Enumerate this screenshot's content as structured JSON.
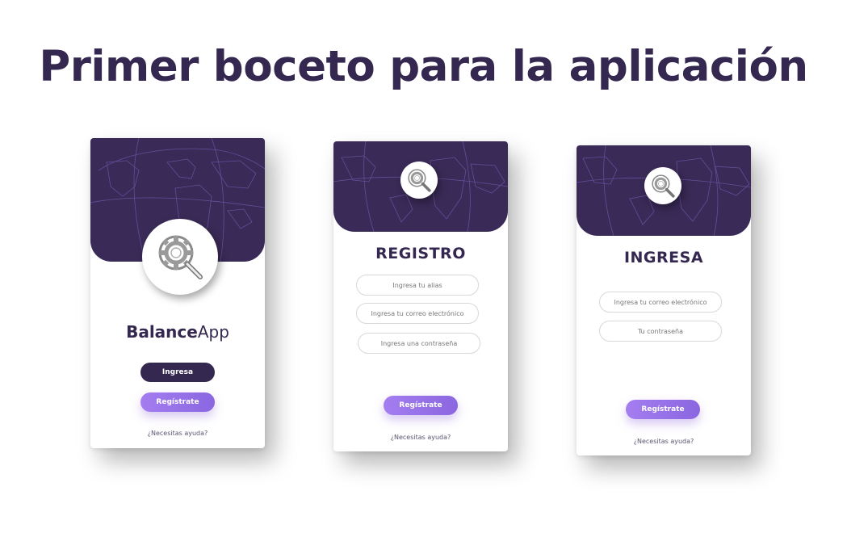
{
  "page": {
    "title": "Primer boceto para la aplicación"
  },
  "splash": {
    "brand_bold": "Balance",
    "brand_regular": "App",
    "login_button": "Ingresa",
    "register_button": "Regístrate",
    "help_link": "¿Necesitas ayuda?"
  },
  "register": {
    "heading": "REGISTRO",
    "fields": [
      {
        "placeholder": "Ingresa tu alias"
      },
      {
        "placeholder": "Ingresa tu correo electrónico"
      },
      {
        "placeholder": "Ingresa una contraseña"
      }
    ],
    "submit_button": "Regístrate",
    "help_link": "¿Necesitas ayuda?"
  },
  "login": {
    "heading": "INGRESA",
    "fields": [
      {
        "placeholder": "Ingresa tu correo electrónico"
      },
      {
        "placeholder": "Tu contraseña"
      }
    ],
    "submit_button": "Regístrate",
    "help_link": "¿Necesitas ayuda?"
  },
  "colors": {
    "primary": "#342750",
    "header": "#3a2a57",
    "accent": "#9b74ea"
  },
  "icons": {
    "header_background": "world-map",
    "logo": "gear-magnifier-icon"
  }
}
